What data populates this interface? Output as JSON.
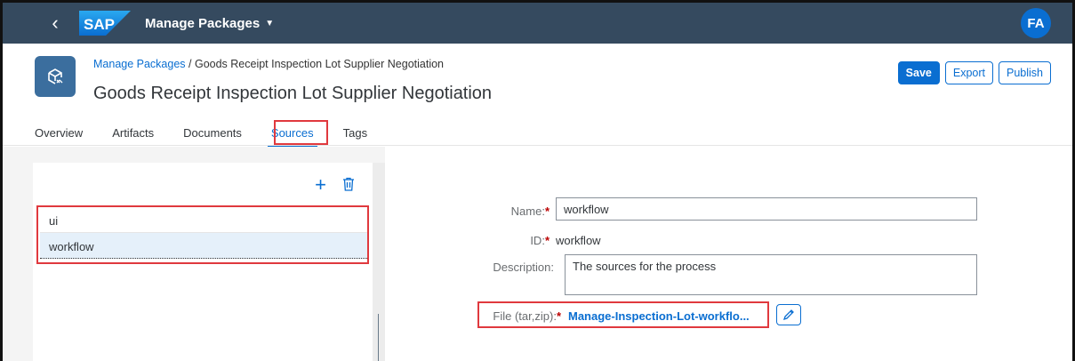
{
  "shell": {
    "logo_text": "SAP",
    "title": "Manage Packages",
    "avatar_initials": "FA",
    "brand_color": "#0a6ed1",
    "shell_color": "#354a5f"
  },
  "header": {
    "breadcrumb_link": "Manage Packages",
    "breadcrumb_separator": " / ",
    "breadcrumb_current": "Goods Receipt Inspection Lot Supplier Negotiation",
    "title": "Goods Receipt Inspection Lot Supplier Negotiation",
    "actions": {
      "save": "Save",
      "export": "Export",
      "publish": "Publish"
    }
  },
  "tabs": [
    {
      "label": "Overview"
    },
    {
      "label": "Artifacts"
    },
    {
      "label": "Documents"
    },
    {
      "label": "Sources",
      "active": true
    },
    {
      "label": "Tags"
    }
  ],
  "sources_list": {
    "items": [
      {
        "label": "ui"
      },
      {
        "label": "workflow",
        "selected": true
      }
    ]
  },
  "form": {
    "name_label": "Name:",
    "name_value": "workflow",
    "id_label": "ID:",
    "id_value": "workflow",
    "description_label": "Description:",
    "description_value": "The sources for the process",
    "file_label": "File (tar,zip):",
    "file_value": "Manage-Inspection-Lot-workflo...",
    "required_marker": "*"
  },
  "highlight_color": "#e0393e"
}
